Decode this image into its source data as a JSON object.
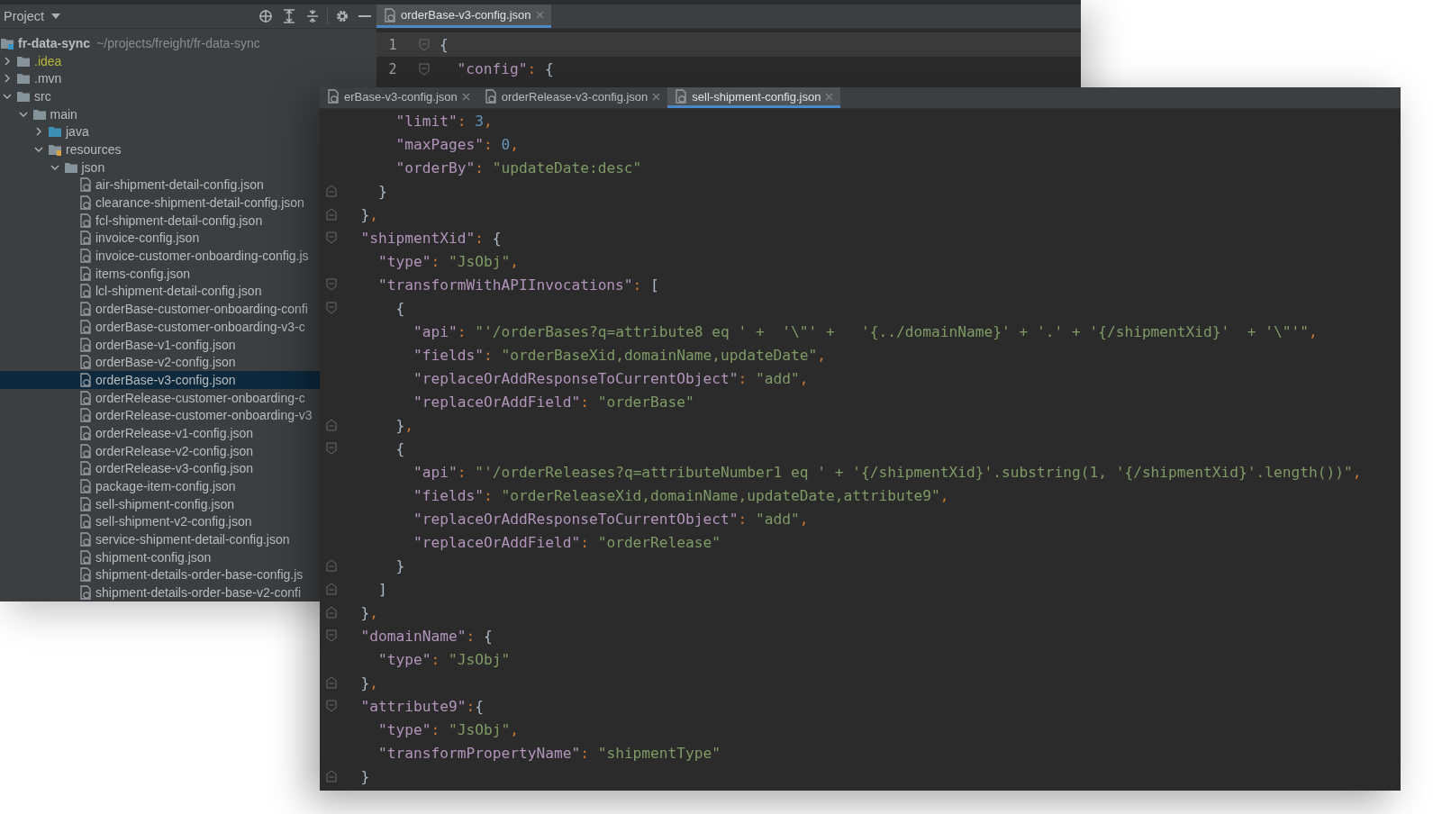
{
  "back_window": {
    "project_panel": {
      "title": "Project",
      "tree": [
        {
          "kind": "project",
          "label": "fr-data-sync",
          "path": "~/projects/freight/fr-data-sync",
          "selected": false,
          "children": [
            {
              "kind": "folder",
              "label": ".idea",
              "ignored": true,
              "expanded": false,
              "selected": false
            },
            {
              "kind": "folder",
              "label": ".mvn",
              "ignored": false,
              "expanded": false,
              "selected": false
            },
            {
              "kind": "folder",
              "label": "src",
              "ignored": false,
              "expanded": true,
              "selected": false,
              "children": [
                {
                  "kind": "folder",
                  "label": "main",
                  "ignored": false,
                  "expanded": true,
                  "selected": false,
                  "children": [
                    {
                      "kind": "source-folder",
                      "label": "java",
                      "ignored": false,
                      "expanded": false,
                      "selected": false
                    },
                    {
                      "kind": "resources-folder",
                      "label": "resources",
                      "ignored": false,
                      "expanded": true,
                      "selected": false,
                      "children": [
                        {
                          "kind": "folder",
                          "label": "json",
                          "ignored": false,
                          "expanded": true,
                          "selected": false,
                          "children": [
                            {
                              "kind": "file",
                              "label": "air-shipment-detail-config.json",
                              "selected": false
                            },
                            {
                              "kind": "file",
                              "label": "clearance-shipment-detail-config.json",
                              "selected": false
                            },
                            {
                              "kind": "file",
                              "label": "fcl-shipment-detail-config.json",
                              "selected": false
                            },
                            {
                              "kind": "file",
                              "label": "invoice-config.json",
                              "selected": false
                            },
                            {
                              "kind": "file",
                              "label": "invoice-customer-onboarding-config.js",
                              "selected": false
                            },
                            {
                              "kind": "file",
                              "label": "items-config.json",
                              "selected": false
                            },
                            {
                              "kind": "file",
                              "label": "lcl-shipment-detail-config.json",
                              "selected": false
                            },
                            {
                              "kind": "file",
                              "label": "orderBase-customer-onboarding-confi",
                              "selected": false
                            },
                            {
                              "kind": "file",
                              "label": "orderBase-customer-onboarding-v3-c",
                              "selected": false
                            },
                            {
                              "kind": "file",
                              "label": "orderBase-v1-config.json",
                              "selected": false
                            },
                            {
                              "kind": "file",
                              "label": "orderBase-v2-config.json",
                              "selected": false
                            },
                            {
                              "kind": "file",
                              "label": "orderBase-v3-config.json",
                              "selected": true
                            },
                            {
                              "kind": "file",
                              "label": "orderRelease-customer-onboarding-c",
                              "selected": false
                            },
                            {
                              "kind": "file",
                              "label": "orderRelease-customer-onboarding-v3",
                              "selected": false
                            },
                            {
                              "kind": "file",
                              "label": "orderRelease-v1-config.json",
                              "selected": false
                            },
                            {
                              "kind": "file",
                              "label": "orderRelease-v2-config.json",
                              "selected": false
                            },
                            {
                              "kind": "file",
                              "label": "orderRelease-v3-config.json",
                              "selected": false
                            },
                            {
                              "kind": "file",
                              "label": "package-item-config.json",
                              "selected": false
                            },
                            {
                              "kind": "file",
                              "label": "sell-shipment-config.json",
                              "selected": false
                            },
                            {
                              "kind": "file",
                              "label": "sell-shipment-v2-config.json",
                              "selected": false
                            },
                            {
                              "kind": "file",
                              "label": "service-shipment-detail-config.json",
                              "selected": false
                            },
                            {
                              "kind": "file",
                              "label": "shipment-config.json",
                              "selected": false
                            },
                            {
                              "kind": "file",
                              "label": "shipment-details-order-base-config.js",
                              "selected": false
                            },
                            {
                              "kind": "file",
                              "label": "shipment-details-order-base-v2-confi",
                              "selected": false
                            }
                          ]
                        }
                      ]
                    }
                  ]
                }
              ]
            }
          ]
        }
      ]
    },
    "tabs": [
      {
        "label": "orderBase-v3-config.json",
        "selected": true
      }
    ],
    "lines": [
      {
        "number": "1",
        "current": true,
        "kind": "fold-start",
        "tokens": [
          {
            "kind": "brace",
            "text": "{"
          }
        ]
      },
      {
        "number": "2",
        "current": false,
        "kind": "fold-start",
        "tokens": [
          {
            "kind": "key",
            "text": "  \"config\""
          },
          {
            "kind": "punct",
            "text": ": "
          },
          {
            "kind": "brace",
            "text": "{"
          }
        ]
      }
    ]
  },
  "front_window": {
    "tabs": [
      {
        "label": "erBase-v3-config.json",
        "selected": false
      },
      {
        "label": "orderRelease-v3-config.json",
        "selected": false
      },
      {
        "label": "sell-shipment-config.json",
        "selected": true
      }
    ],
    "lines": [
      {
        "kind": "plain",
        "tokens": [
          {
            "kind": "key",
            "text": "      \"limit\""
          },
          {
            "kind": "punct",
            "text": ": "
          },
          {
            "kind": "number",
            "text": "3"
          },
          {
            "kind": "punct",
            "text": ","
          }
        ]
      },
      {
        "kind": "plain",
        "tokens": [
          {
            "kind": "key",
            "text": "      \"maxPages\""
          },
          {
            "kind": "punct",
            "text": ": "
          },
          {
            "kind": "number",
            "text": "0"
          },
          {
            "kind": "punct",
            "text": ","
          }
        ]
      },
      {
        "kind": "plain",
        "tokens": [
          {
            "kind": "key",
            "text": "      \"orderBy\""
          },
          {
            "kind": "punct",
            "text": ": "
          },
          {
            "kind": "string",
            "text": "\"updateDate:desc\""
          }
        ]
      },
      {
        "kind": "fold-end",
        "tokens": [
          {
            "kind": "brace",
            "text": "    }"
          }
        ]
      },
      {
        "kind": "fold-end",
        "tokens": [
          {
            "kind": "brace",
            "text": "  }"
          },
          {
            "kind": "punct",
            "text": ","
          }
        ]
      },
      {
        "kind": "fold-start",
        "tokens": [
          {
            "kind": "key",
            "text": "  \"shipmentXid\""
          },
          {
            "kind": "punct",
            "text": ": "
          },
          {
            "kind": "brace",
            "text": "{"
          }
        ]
      },
      {
        "kind": "plain",
        "tokens": [
          {
            "kind": "key",
            "text": "    \"type\""
          },
          {
            "kind": "punct",
            "text": ": "
          },
          {
            "kind": "string",
            "text": "\"JsObj\""
          },
          {
            "kind": "punct",
            "text": ","
          }
        ]
      },
      {
        "kind": "fold-start",
        "tokens": [
          {
            "kind": "key",
            "text": "    \"transformWithAPIInvocations\""
          },
          {
            "kind": "punct",
            "text": ": "
          },
          {
            "kind": "brace",
            "text": "["
          }
        ]
      },
      {
        "kind": "fold-start",
        "tokens": [
          {
            "kind": "brace",
            "text": "      {"
          }
        ]
      },
      {
        "kind": "plain",
        "tokens": [
          {
            "kind": "key",
            "text": "        \"api\""
          },
          {
            "kind": "punct",
            "text": ": "
          },
          {
            "kind": "string",
            "text": "\"'/orderBases?q=attribute8 eq ' +  '\\\"' +   '{../domainName}' + '.' + '{/shipmentXid}'  + '\\\"'\""
          },
          {
            "kind": "punct",
            "text": ","
          }
        ]
      },
      {
        "kind": "plain",
        "tokens": [
          {
            "kind": "key",
            "text": "        \"fields\""
          },
          {
            "kind": "punct",
            "text": ": "
          },
          {
            "kind": "string",
            "text": "\"orderBaseXid,domainName,updateDate\""
          },
          {
            "kind": "punct",
            "text": ","
          }
        ]
      },
      {
        "kind": "plain",
        "tokens": [
          {
            "kind": "key",
            "text": "        \"replaceOrAddResponseToCurrentObject\""
          },
          {
            "kind": "punct",
            "text": ": "
          },
          {
            "kind": "string",
            "text": "\"add\""
          },
          {
            "kind": "punct",
            "text": ","
          }
        ]
      },
      {
        "kind": "plain",
        "tokens": [
          {
            "kind": "key",
            "text": "        \"replaceOrAddField\""
          },
          {
            "kind": "punct",
            "text": ": "
          },
          {
            "kind": "string",
            "text": "\"orderBase\""
          }
        ]
      },
      {
        "kind": "fold-end",
        "tokens": [
          {
            "kind": "brace",
            "text": "      }"
          },
          {
            "kind": "punct",
            "text": ","
          }
        ]
      },
      {
        "kind": "fold-start",
        "tokens": [
          {
            "kind": "brace",
            "text": "      {"
          }
        ]
      },
      {
        "kind": "plain",
        "tokens": [
          {
            "kind": "key",
            "text": "        \"api\""
          },
          {
            "kind": "punct",
            "text": ": "
          },
          {
            "kind": "string",
            "text": "\"'/orderReleases?q=attributeNumber1 eq ' + '{/shipmentXid}'.substring(1, '{/shipmentXid}'.length())\""
          },
          {
            "kind": "punct",
            "text": ","
          }
        ]
      },
      {
        "kind": "plain",
        "tokens": [
          {
            "kind": "key",
            "text": "        \"fields\""
          },
          {
            "kind": "punct",
            "text": ": "
          },
          {
            "kind": "string",
            "text": "\"orderReleaseXid,domainName,updateDate,attribute9\""
          },
          {
            "kind": "punct",
            "text": ","
          }
        ]
      },
      {
        "kind": "plain",
        "tokens": [
          {
            "kind": "key",
            "text": "        \"replaceOrAddResponseToCurrentObject\""
          },
          {
            "kind": "punct",
            "text": ": "
          },
          {
            "kind": "string",
            "text": "\"add\""
          },
          {
            "kind": "punct",
            "text": ","
          }
        ]
      },
      {
        "kind": "plain",
        "tokens": [
          {
            "kind": "key",
            "text": "        \"replaceOrAddField\""
          },
          {
            "kind": "punct",
            "text": ": "
          },
          {
            "kind": "string",
            "text": "\"orderRelease\""
          }
        ]
      },
      {
        "kind": "fold-end",
        "tokens": [
          {
            "kind": "brace",
            "text": "      }"
          }
        ]
      },
      {
        "kind": "fold-end",
        "tokens": [
          {
            "kind": "brace",
            "text": "    ]"
          }
        ]
      },
      {
        "kind": "fold-end",
        "tokens": [
          {
            "kind": "brace",
            "text": "  }"
          },
          {
            "kind": "punct",
            "text": ","
          }
        ]
      },
      {
        "kind": "fold-start",
        "tokens": [
          {
            "kind": "key",
            "text": "  \"domainName\""
          },
          {
            "kind": "punct",
            "text": ": "
          },
          {
            "kind": "brace",
            "text": "{"
          }
        ]
      },
      {
        "kind": "plain",
        "tokens": [
          {
            "kind": "key",
            "text": "    \"type\""
          },
          {
            "kind": "punct",
            "text": ": "
          },
          {
            "kind": "string",
            "text": "\"JsObj\""
          }
        ]
      },
      {
        "kind": "fold-end",
        "tokens": [
          {
            "kind": "brace",
            "text": "  }"
          },
          {
            "kind": "punct",
            "text": ","
          }
        ]
      },
      {
        "kind": "fold-start",
        "tokens": [
          {
            "kind": "key",
            "text": "  \"attribute9\""
          },
          {
            "kind": "punct",
            "text": ":"
          },
          {
            "kind": "brace",
            "text": "{"
          }
        ]
      },
      {
        "kind": "plain",
        "tokens": [
          {
            "kind": "key",
            "text": "    \"type\""
          },
          {
            "kind": "punct",
            "text": ": "
          },
          {
            "kind": "string",
            "text": "\"JsObj\""
          },
          {
            "kind": "punct",
            "text": ","
          }
        ]
      },
      {
        "kind": "plain",
        "tokens": [
          {
            "kind": "key",
            "text": "    \"transformPropertyName\""
          },
          {
            "kind": "punct",
            "text": ": "
          },
          {
            "kind": "string",
            "text": "\"shipmentType\""
          }
        ]
      },
      {
        "kind": "fold-end",
        "tokens": [
          {
            "kind": "brace",
            "text": "  }"
          }
        ]
      }
    ]
  }
}
